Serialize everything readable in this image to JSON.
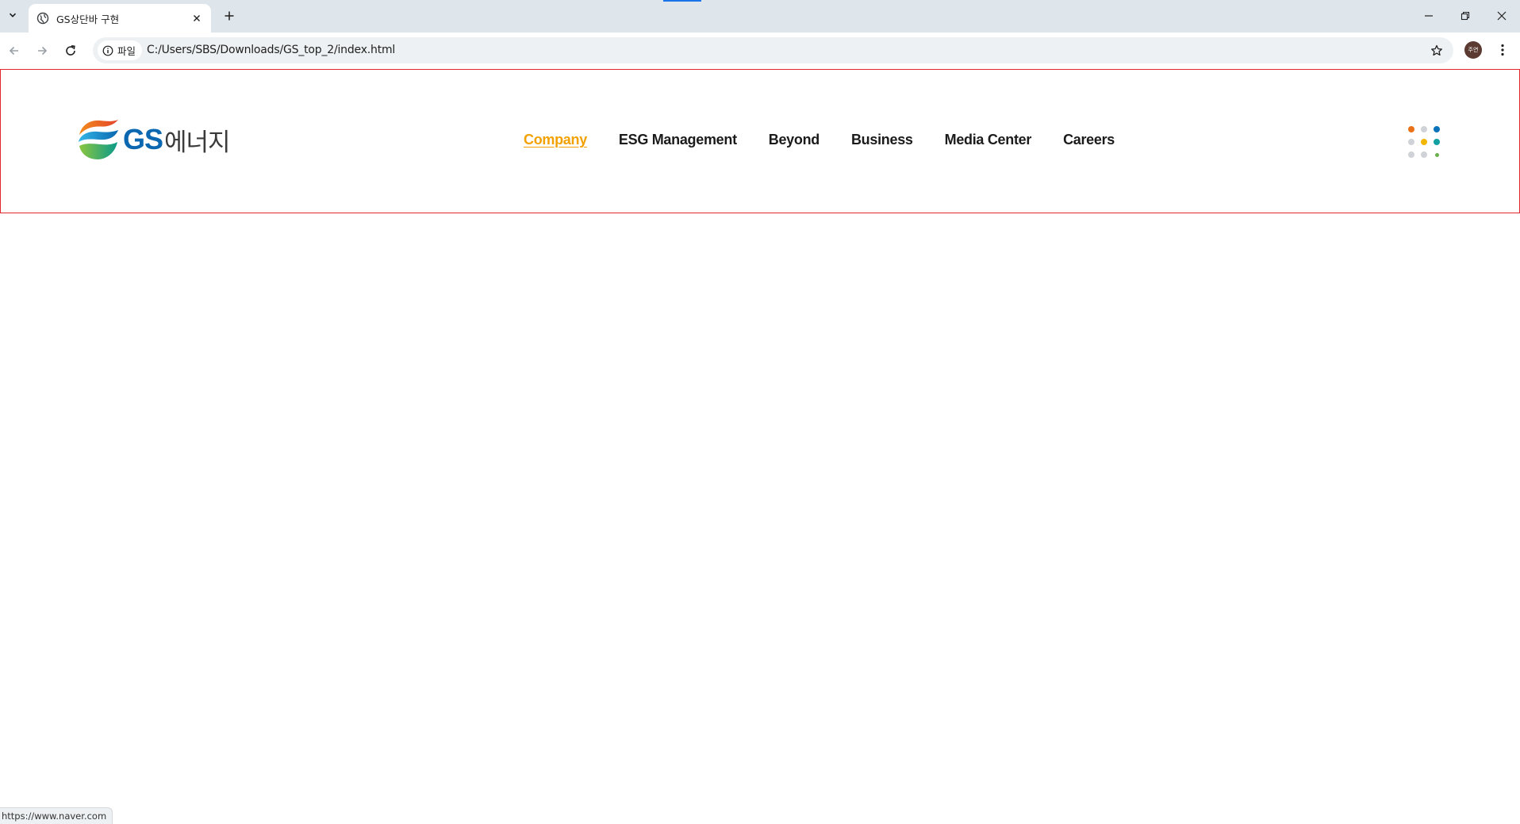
{
  "browser": {
    "tab": {
      "title": "GS상단바 구현",
      "favicon": "globe-icon"
    },
    "site_chip_label": "파일",
    "url": "C:/Users/SBS/Downloads/GS_top_2/index.html",
    "profile_initials": "주연",
    "status_url": "https://www.naver.com"
  },
  "header": {
    "logo": {
      "brand": "GS",
      "suffix": "에너지"
    },
    "nav": [
      {
        "label": "Company",
        "active": true
      },
      {
        "label": "ESG Management",
        "active": false
      },
      {
        "label": "Beyond",
        "active": false
      },
      {
        "label": "Business",
        "active": false
      },
      {
        "label": "Media Center",
        "active": false
      },
      {
        "label": "Careers",
        "active": false
      }
    ],
    "dot_colors": [
      "#e8711a",
      "#cfd2d6",
      "#0a72b8",
      "#cfd2d6",
      "#f2b705",
      "#12a0a3",
      "#cfd2d6",
      "#cfd2d6",
      "#6ab04c"
    ]
  },
  "colors": {
    "accent": "#f2a100",
    "header_border": "#e2272c",
    "brand_blue": "#0a67b0"
  }
}
